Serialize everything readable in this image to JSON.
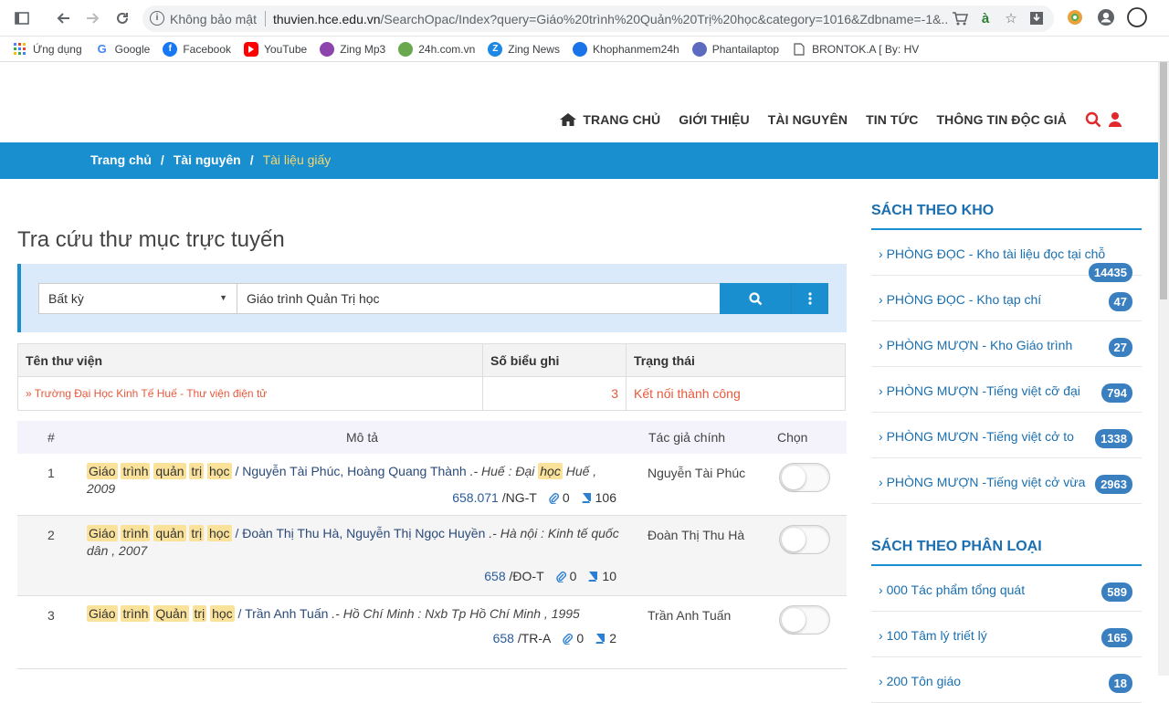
{
  "browser": {
    "not_secure": "Không bảo mật",
    "url_host": "thuvien.hce.edu.vn",
    "url_rest": "/SearchOpac/Index?query=Giáo%20trình%20Quản%20Trị%20học&category=1016&Zdbname=-1&..."
  },
  "bookmarks": [
    {
      "label": "Ứng dụng",
      "icon": "apps-grid-icon",
      "color": "#4285f4"
    },
    {
      "label": "Google",
      "icon": "google-icon",
      "color": "#4285f4"
    },
    {
      "label": "Facebook",
      "icon": "facebook-icon",
      "color": "#1877f2"
    },
    {
      "label": "YouTube",
      "icon": "youtube-icon",
      "color": "#ff0000"
    },
    {
      "label": "Zing Mp3",
      "icon": "zing-mp3-icon",
      "color": "#8e44ad"
    },
    {
      "label": "24h.com.vn",
      "icon": "24h-icon",
      "color": "#6aa84f"
    },
    {
      "label": "Zing News",
      "icon": "zing-news-icon",
      "color": "#1e88e5"
    },
    {
      "label": "Khophanmem24h",
      "icon": "khophanmem-icon",
      "color": "#1a73e8"
    },
    {
      "label": "Phantailaptop",
      "icon": "phantailaptop-icon",
      "color": "#5c6bc0"
    },
    {
      "label": "BRONTOK.A [ By: HV",
      "icon": "page-icon",
      "color": "#777"
    }
  ],
  "nav": {
    "home": "TRANG CHỦ",
    "about": "GIỚI THIỆU",
    "resources": "TÀI NGUYÊN",
    "news": "TIN TỨC",
    "reader_info": "THÔNG TIN ĐỘC GIẢ"
  },
  "breadcrumb": {
    "home": "Trang chủ",
    "sep": "/",
    "resources": "Tài nguyên",
    "current": "Tài liệu giấy"
  },
  "page_title": "Tra cứu thư mục trực tuyến",
  "search": {
    "field_select": "Bất kỳ",
    "query": "Giáo trình Quản Trị học"
  },
  "library_table": {
    "headers": [
      "Tên thư viện",
      "Số biểu ghi",
      "Trạng thái"
    ],
    "row": {
      "name": "» Trường Đại Học Kinh Tế Huế - Thư viện điện tử",
      "count": "3",
      "status": "Kết nối thành công"
    }
  },
  "results": {
    "headers": {
      "num": "#",
      "desc": "Mô tả",
      "author": "Tác giả chính",
      "select": "Chọn"
    },
    "rows": [
      {
        "num": "1",
        "title_words": [
          "Giáo",
          "trình",
          "quản",
          "trị",
          "học"
        ],
        "authors": "/ Nguyễn Tài Phúc, Hoàng Quang Thành",
        "pub_prefix": ".- Huế : Đại",
        "pub_hl": "học",
        "pub_suffix": "Huế , 2009",
        "class_num": "658.071",
        "class_code": "/NG-T",
        "attach": "0",
        "copies": "106",
        "author": "Nguyễn Tài Phúc"
      },
      {
        "num": "2",
        "title_words": [
          "Giáo",
          "trình",
          "quản",
          "trị",
          "học"
        ],
        "authors": "/ Đoàn Thị Thu Hà, Nguyễn Thị Ngọc Huyền",
        "pub_prefix": ".- Hà nội : Kinh tế quốc dân , 2007",
        "pub_hl": "",
        "pub_suffix": "",
        "class_num": "658",
        "class_code": "/ĐO-T",
        "attach": "0",
        "copies": "10",
        "author": "Đoàn Thị Thu Hà"
      },
      {
        "num": "3",
        "title_words": [
          "Giáo",
          "trình",
          "Quản",
          "trị",
          "học"
        ],
        "authors": "/ Trần Anh Tuấn",
        "pub_prefix": ".- Hồ Chí Minh : Nxb Tp Hồ Chí Minh , 1995",
        "pub_hl": "",
        "pub_suffix": "",
        "class_num": "658",
        "class_code": "/TR-A",
        "attach": "0",
        "copies": "2",
        "author": "Trần Anh Tuấn"
      }
    ]
  },
  "sidebar": {
    "by_store_title": "SÁCH THEO KHO",
    "by_store": [
      {
        "label": "PHÒNG ĐỌC - Kho tài liệu đọc tại chỗ",
        "count": "14435"
      },
      {
        "label": "PHÒNG ĐỌC - Kho tạp chí",
        "count": "47"
      },
      {
        "label": "PHÒNG MƯỢN - Kho Giáo trình",
        "count": "27"
      },
      {
        "label": "PHÒNG MƯỢN -Tiếng việt cỡ đại",
        "count": "794"
      },
      {
        "label": "PHÒNG MƯỢN -Tiếng việt cở to",
        "count": "1338"
      },
      {
        "label": "PHÒNG MƯỢN -Tiếng việt cở vừa",
        "count": "2963"
      }
    ],
    "by_category_title": "SÁCH THEO PHÂN LOẠI",
    "by_category": [
      {
        "label": "000 Tác phẩm tổng quát",
        "count": "589"
      },
      {
        "label": "100 Tâm lý triết lý",
        "count": "165"
      },
      {
        "label": "200 Tôn giáo",
        "count": "18"
      }
    ]
  },
  "colors": {
    "accent": "#1a8fd0",
    "highlight": "#fbe29a",
    "link_red": "#e8593c",
    "breadcrumb_active": "#f5d76e"
  }
}
